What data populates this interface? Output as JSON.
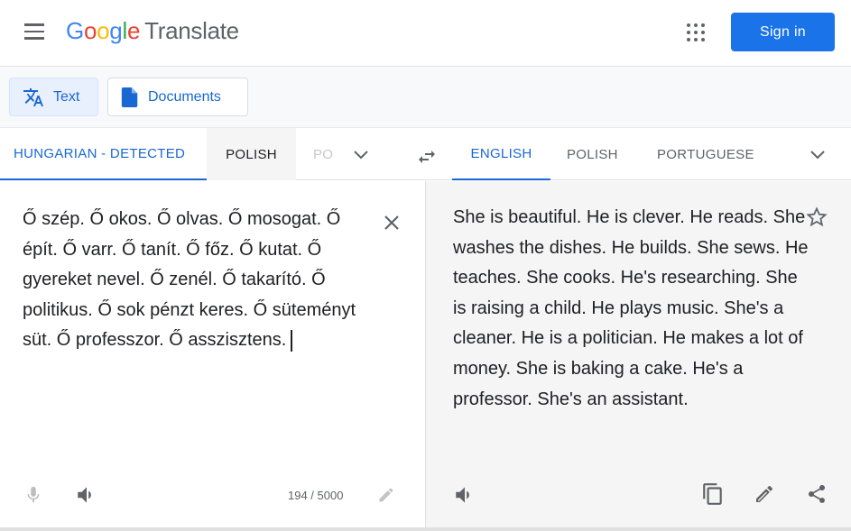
{
  "header": {
    "logo_google": "Google",
    "logo_product": "Translate",
    "signin": "Sign in"
  },
  "toolbar": {
    "text": "Text",
    "documents": "Documents"
  },
  "source_langs": [
    "HUNGARIAN - DETECTED",
    "POLISH",
    "PO"
  ],
  "target_langs": [
    "ENGLISH",
    "POLISH",
    "PORTUGUESE"
  ],
  "source": {
    "text": "Ő szép. Ő okos. Ő olvas. Ő mosogat. Ő épít. Ő varr. Ő tanít. Ő főz. Ő kutat. Ő gyereket nevel. Ő zenél. Ő takarító. Ő politikus. Ő sok pénzt keres. Ő süteményt süt. Ő professzor. Ő asszisztens.",
    "char_count": "194 / 5000"
  },
  "target": {
    "text": "She is beautiful. He is clever. He reads. She washes the dishes. He builds. She sews. He teaches. She cooks. He's researching. She is raising a child. He plays music. She's a cleaner. He is a politician. He makes a lot of money. She is baking a cake. He's a professor. She's an assistant."
  },
  "colors": {
    "accent": "#1a73e8",
    "selected_tab": "#1967d2"
  }
}
